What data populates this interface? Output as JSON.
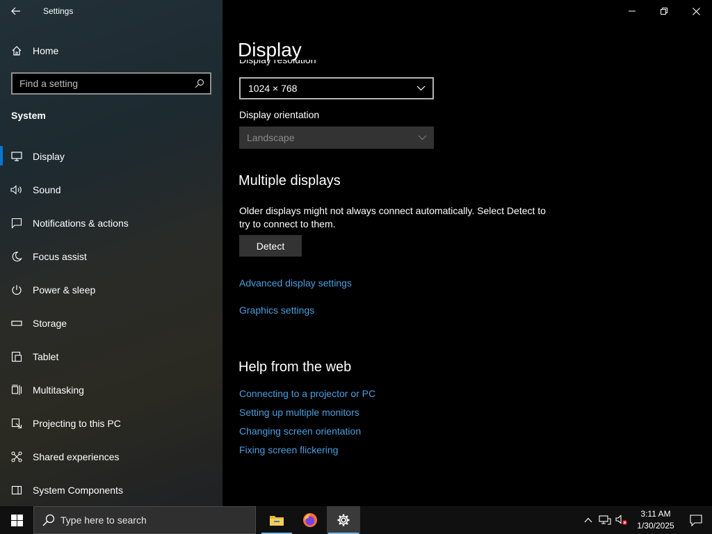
{
  "window": {
    "title": "Settings"
  },
  "sidebar": {
    "home_label": "Home",
    "search_placeholder": "Find a setting",
    "section": "System",
    "items": [
      {
        "label": "Display",
        "icon": "monitor-icon"
      },
      {
        "label": "Sound",
        "icon": "speaker-icon"
      },
      {
        "label": "Notifications & actions",
        "icon": "message-icon"
      },
      {
        "label": "Focus assist",
        "icon": "moon-icon"
      },
      {
        "label": "Power & sleep",
        "icon": "power-icon"
      },
      {
        "label": "Storage",
        "icon": "storage-icon"
      },
      {
        "label": "Tablet",
        "icon": "tablet-icon"
      },
      {
        "label": "Multitasking",
        "icon": "multitasking-icon"
      },
      {
        "label": "Projecting to this PC",
        "icon": "projecting-icon"
      },
      {
        "label": "Shared experiences",
        "icon": "shared-icon"
      },
      {
        "label": "System Components",
        "icon": "components-icon"
      }
    ]
  },
  "main": {
    "title": "Display",
    "resolution_label": "Display resolution",
    "resolution_value": "1024 × 768",
    "orientation_label": "Display orientation",
    "orientation_value": "Landscape",
    "multiple_displays": {
      "title": "Multiple displays",
      "description": "Older displays might not always connect automatically. Select Detect to try to connect to them.",
      "detect_label": "Detect"
    },
    "advanced_link": "Advanced display settings",
    "graphics_link": "Graphics settings",
    "help": {
      "title": "Help from the web",
      "links": [
        "Connecting to a projector or PC",
        "Setting up multiple monitors",
        "Changing screen orientation",
        "Fixing screen flickering"
      ]
    }
  },
  "taskbar": {
    "search_placeholder": "Type here to search",
    "time": "3:11 AM",
    "date": "1/30/2025"
  },
  "colors": {
    "accent": "#0078d7",
    "link": "#4a9fe0"
  }
}
